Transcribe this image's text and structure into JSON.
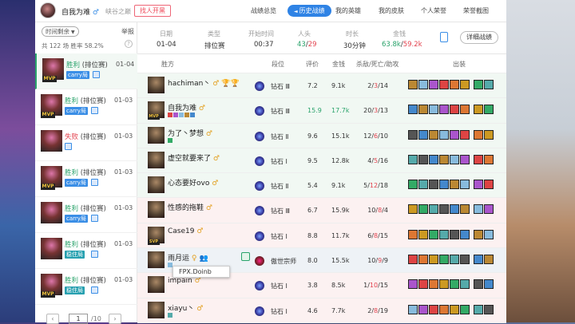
{
  "user": {
    "name": "自我为难",
    "gender": "♂",
    "region": "峡谷之巅",
    "find_btn": "找人开黑"
  },
  "nav": [
    {
      "label": "战绩总览"
    },
    {
      "label": "历史战绩"
    },
    {
      "label": "我的英雄"
    },
    {
      "label": "我的皮肤"
    },
    {
      "label": "个人荣誉"
    },
    {
      "label": "荣誉截图"
    }
  ],
  "sidebar": {
    "filter": "时间剩余",
    "report": "举报",
    "total": "共 122 场",
    "winrate_label": "胜率",
    "winrate": "58.2%",
    "matches": [
      {
        "result": "胜利",
        "mode": "(排位赛)",
        "date": "01-04",
        "badge": "MVP",
        "tag": "carry局",
        "tag_color": "b"
      },
      {
        "result": "胜利",
        "mode": "(排位赛)",
        "date": "01-03",
        "badge": "MVP",
        "tag": "carry局",
        "tag_color": "b"
      },
      {
        "result": "失败",
        "mode": "(排位赛)",
        "date": "01-03",
        "badge": "",
        "tag": "",
        "tag_color": "b"
      },
      {
        "result": "胜利",
        "mode": "(排位赛)",
        "date": "01-03",
        "badge": "MVP",
        "tag": "carry局",
        "tag_color": "b"
      },
      {
        "result": "胜利",
        "mode": "(排位赛)",
        "date": "01-03",
        "badge": "",
        "tag": "carry局",
        "tag_color": "b"
      },
      {
        "result": "胜利",
        "mode": "(排位赛)",
        "date": "01-03",
        "badge": "",
        "tag": "稳住局",
        "tag_color": "g"
      },
      {
        "result": "胜利",
        "mode": "(排位赛)",
        "date": "01-03",
        "badge": "MVP",
        "tag": "稳住局",
        "tag_color": "g"
      }
    ],
    "page": "1",
    "total_pages": "/10",
    "prev": "‹",
    "next": "›"
  },
  "summary": {
    "date_label": "日期",
    "date": "01-04",
    "type_label": "类型",
    "type": "排位赛",
    "start_label": "开始时间",
    "start": "00:37",
    "kills_label": "人头",
    "kills_a": "43",
    "kills_b": "29",
    "duration_label": "时长",
    "duration": "30分钟",
    "gold_label": "金钱",
    "gold_a": "63.8k",
    "gold_b": "59.2k",
    "detail_btn": "详细战绩"
  },
  "table": {
    "h_side": "胜方",
    "h_rank": "段位",
    "h_score": "评价",
    "h_gold": "金钱",
    "h_kda": "杀敌/死亡/助攻",
    "h_items": "出装"
  },
  "players": [
    {
      "name": "hachiman丶",
      "extra": "♂ 🏆🏆",
      "badge": "",
      "rank": "钻石 Ⅲ",
      "score": "7.2",
      "gold": "9.1k",
      "k": "2",
      "d": "3",
      "a": "14",
      "win": true,
      "hl": false,
      "gm": false,
      "sub": 0
    },
    {
      "name": "自我为难",
      "extra": "♂",
      "badge": "MVP",
      "rank": "钻石 Ⅲ",
      "score": "15.9",
      "gold": "17.7k",
      "k": "20",
      "d": "3",
      "a": "13",
      "win": true,
      "hl": true,
      "gm": false,
      "sub": 5
    },
    {
      "name": "为了丶梦想",
      "extra": "♂",
      "badge": "",
      "rank": "钻石 Ⅱ",
      "score": "9.6",
      "gold": "15.1k",
      "k": "12",
      "d": "6",
      "a": "10",
      "win": true,
      "hl": false,
      "gm": false,
      "sub": 1
    },
    {
      "name": "虚空就要来了",
      "extra": "♂",
      "badge": "",
      "rank": "钻石 Ⅰ",
      "score": "9.5",
      "gold": "12.8k",
      "k": "4",
      "d": "5",
      "a": "16",
      "win": true,
      "hl": false,
      "gm": false,
      "sub": 0
    },
    {
      "name": "心态要好ovo",
      "extra": "♂",
      "badge": "",
      "rank": "钻石 Ⅱ",
      "score": "5.4",
      "gold": "9.1k",
      "k": "5",
      "d": "12",
      "a": "18",
      "win": true,
      "hl": false,
      "gm": false,
      "sub": 0
    },
    {
      "name": "性感的拖鞋",
      "extra": "♂",
      "badge": "",
      "rank": "钻石 Ⅲ",
      "score": "6.7",
      "gold": "15.9k",
      "k": "10",
      "d": "8",
      "a": "4",
      "win": false,
      "hl": false,
      "gm": false,
      "sub": 0
    },
    {
      "name": "Case19",
      "extra": "♂",
      "badge": "SVP",
      "rank": "钻石 Ⅰ",
      "score": "8.8",
      "gold": "11.7k",
      "k": "6",
      "d": "8",
      "a": "15",
      "win": false,
      "hl": false,
      "gm": false,
      "sub": 0
    },
    {
      "name": "雨月运",
      "extra": "♀ 👥",
      "badge": "",
      "rank": "傲世宗师",
      "score": "8.0",
      "gold": "15.5k",
      "k": "10",
      "d": "9",
      "a": "9",
      "win": false,
      "hl": false,
      "gm": true,
      "sub": 1
    },
    {
      "name": "impain",
      "extra": "♂",
      "badge": "",
      "rank": "钻石 Ⅰ",
      "score": "3.8",
      "gold": "8.5k",
      "k": "1",
      "d": "10",
      "a": "15",
      "win": false,
      "hl": false,
      "gm": false,
      "sub": 0
    },
    {
      "name": "xiayu丶",
      "extra": "♂",
      "badge": "",
      "rank": "钻石 Ⅰ",
      "score": "4.6",
      "gold": "7.7k",
      "k": "2",
      "d": "8",
      "a": "19",
      "win": false,
      "hl": false,
      "gm": false,
      "sub": 1
    }
  ],
  "tooltip": "FPX.Doinb",
  "colors": {
    "win": "#2aa36b",
    "lose": "#e3434f",
    "accent": "#2f83e5"
  }
}
